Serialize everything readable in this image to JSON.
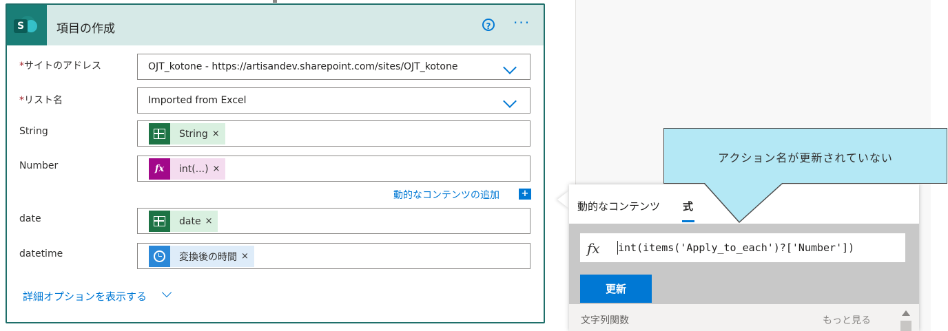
{
  "card": {
    "title": "項目の作成",
    "help_glyph": "?",
    "more_glyph": "···",
    "fields": {
      "site_address": {
        "required_mark": "*",
        "label": "サイトのアドレス",
        "value": "OJT_kotone - https://artisandev.sharepoint.com/sites/OJT_kotone"
      },
      "list_name": {
        "required_mark": "*",
        "label": "リスト名",
        "value": "Imported from Excel"
      },
      "string": {
        "label": "String",
        "token": "String",
        "token_icon": "excel-icon"
      },
      "number": {
        "label": "Number",
        "token": "int(...)",
        "token_icon": "fx-icon",
        "token_icon_text": "fx"
      },
      "date": {
        "label": "date",
        "token": "date",
        "token_icon": "excel-icon"
      },
      "datetime": {
        "label": "datetime",
        "token": "変換後の時間",
        "token_icon": "clock-icon"
      }
    },
    "token_remove": "×",
    "add_dynamic_content": "動的なコンテンツの追加",
    "add_dynamic_icon": "+",
    "show_advanced": "詳細オプションを表示する"
  },
  "popup": {
    "tabs": [
      {
        "label": "動的なコンテンツ",
        "active": false
      },
      {
        "label": "式",
        "active": true
      }
    ],
    "fx_label": "fx",
    "expression": "int(items('Apply_to_each')?['Number'])",
    "update_button": "更新",
    "function_category": "文字列関数",
    "see_more": "もっと見る"
  },
  "callout": {
    "text": "アクション名が更新されていない"
  },
  "colors": {
    "accent": "#0078d4",
    "card_border": "#1f6f6a",
    "header_bg": "#d6e9e7",
    "excel_green": "#1d7345",
    "expression_purple": "#a2088a",
    "callout_fill": "#b4e8f5",
    "required_red": "#a4262c"
  }
}
